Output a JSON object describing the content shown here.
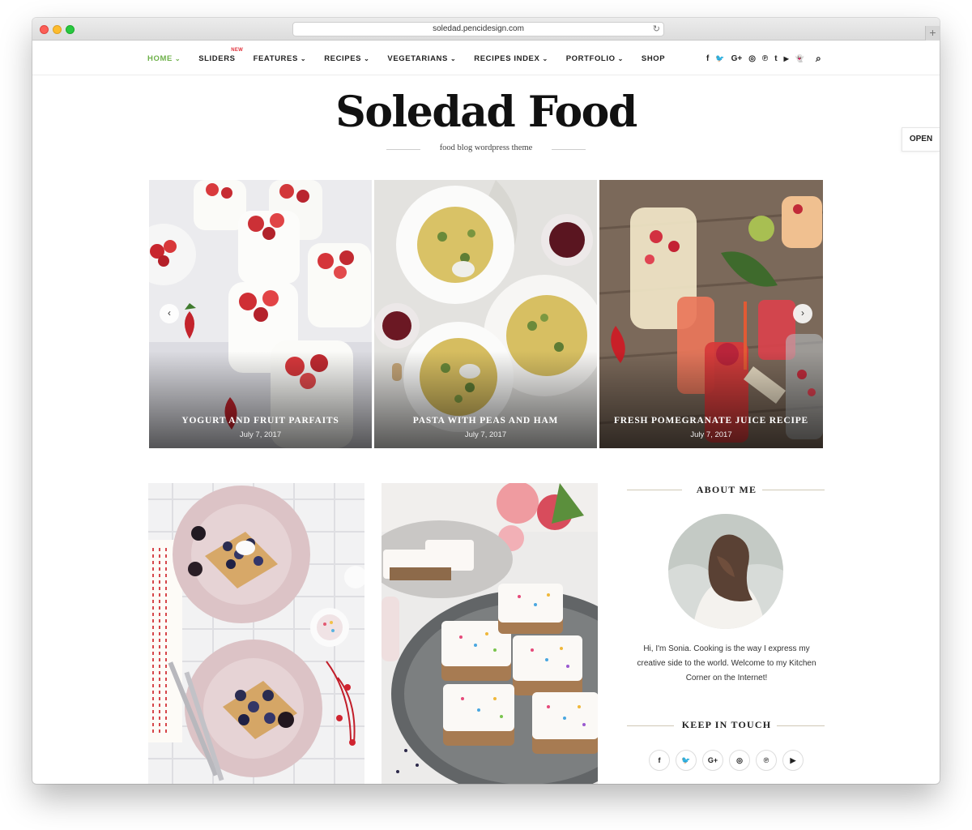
{
  "browser": {
    "url": "soledad.pencidesign.com",
    "reload_icon": "reload-icon",
    "newtab_symbol": "+"
  },
  "nav": {
    "items": [
      {
        "label": "HOME",
        "caret": "⌄",
        "active": true
      },
      {
        "label": "SLIDERS",
        "badge": "NEW"
      },
      {
        "label": "FEATURES",
        "caret": "⌄"
      },
      {
        "label": "RECIPES",
        "caret": "⌄"
      },
      {
        "label": "VEGETARIANS",
        "caret": "⌄"
      },
      {
        "label": "RECIPES INDEX",
        "caret": "⌄"
      },
      {
        "label": "PORTFOLIO",
        "caret": "⌄"
      },
      {
        "label": "SHOP"
      }
    ],
    "social": [
      {
        "icon": "facebook-icon",
        "glyph": "f"
      },
      {
        "icon": "twitter-icon",
        "glyph": "🐦"
      },
      {
        "icon": "google-plus-icon",
        "glyph": "G+"
      },
      {
        "icon": "instagram-icon",
        "glyph": "◎"
      },
      {
        "icon": "pinterest-icon",
        "glyph": "℗"
      },
      {
        "icon": "tumblr-icon",
        "glyph": "t"
      },
      {
        "icon": "youtube-icon",
        "glyph": "▶"
      },
      {
        "icon": "snapchat-icon",
        "glyph": "👻"
      }
    ],
    "search_icon": "⌕",
    "active_color": "#6eb14a"
  },
  "header": {
    "logo": "Soledad Food",
    "tagline": "food blog wordpress theme"
  },
  "open_button": "OPEN",
  "slider": {
    "prev": "‹",
    "next": "›",
    "slides": [
      {
        "title": "YOGURT AND FRUIT PARFAITS",
        "date": "July 7, 2017"
      },
      {
        "title": "PASTA WITH PEAS AND HAM",
        "date": "July 7, 2017"
      },
      {
        "title": "FRESH POMEGRANATE JUICE RECIPE",
        "date": "July 7, 2017"
      }
    ]
  },
  "sidebar": {
    "about_title": "ABOUT ME",
    "about_text": "Hi, I'm Sonia. Cooking is the way I express my creative side to the world. Welcome to my Kitchen Corner on the Internet!",
    "keep_title": "KEEP IN TOUCH",
    "social": [
      {
        "icon": "facebook-icon",
        "glyph": "f"
      },
      {
        "icon": "twitter-icon",
        "glyph": "🐦"
      },
      {
        "icon": "google-plus-icon",
        "glyph": "G+"
      },
      {
        "icon": "instagram-icon",
        "glyph": "◎"
      },
      {
        "icon": "pinterest-icon",
        "glyph": "℗"
      },
      {
        "icon": "youtube-icon",
        "glyph": "▶"
      }
    ]
  }
}
